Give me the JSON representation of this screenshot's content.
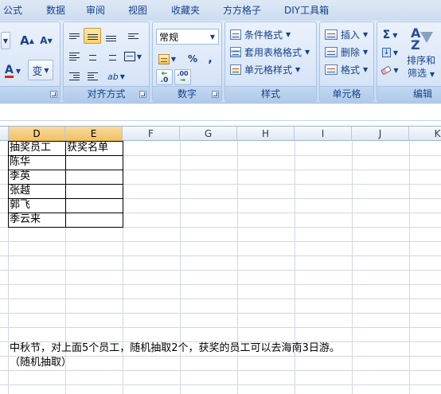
{
  "tabs": [
    "公式",
    "数据",
    "审阅",
    "视图",
    "收藏夹",
    "方方格子",
    "DIY工具箱"
  ],
  "ribbon": {
    "font": {
      "grow": "A",
      "shrink": "A",
      "color_letter": "A",
      "wen_label": "变"
    },
    "alignment": {
      "label": "对齐方式"
    },
    "number": {
      "label": "数字",
      "format": "常规",
      "percent": "%",
      "comma": ",",
      "inc_decimal": ".0",
      "dec_decimal": ".00"
    },
    "styles": {
      "label": "样式",
      "conditional": "条件格式",
      "table": "套用表格格式",
      "cell_styles": "单元格样式"
    },
    "cells": {
      "label": "单元格",
      "insert": "插入",
      "delete": "删除",
      "format": "格式"
    },
    "editing": {
      "label": "编辑",
      "sum": "Σ",
      "sort_line1": "排序和",
      "sort_line2": "筛选"
    }
  },
  "columns": [
    "D",
    "E",
    "F",
    "G",
    "H",
    "I",
    "J",
    "K"
  ],
  "table": {
    "header": [
      "抽奖员工",
      "获奖名单"
    ],
    "rows": [
      [
        "陈华",
        ""
      ],
      [
        "李英",
        ""
      ],
      [
        "张越",
        ""
      ],
      [
        "郭飞",
        ""
      ],
      [
        "季云来",
        ""
      ]
    ]
  },
  "notes": {
    "line1": "中秋节，对上面5个员工，随机抽取2个，获奖的员工可以去海南3日游。",
    "line2": "（随机抽取）"
  },
  "colors": {
    "selected_header": "#f1c15f",
    "ribbon": "#d5e3f5",
    "grid": "#d0d7e5"
  }
}
